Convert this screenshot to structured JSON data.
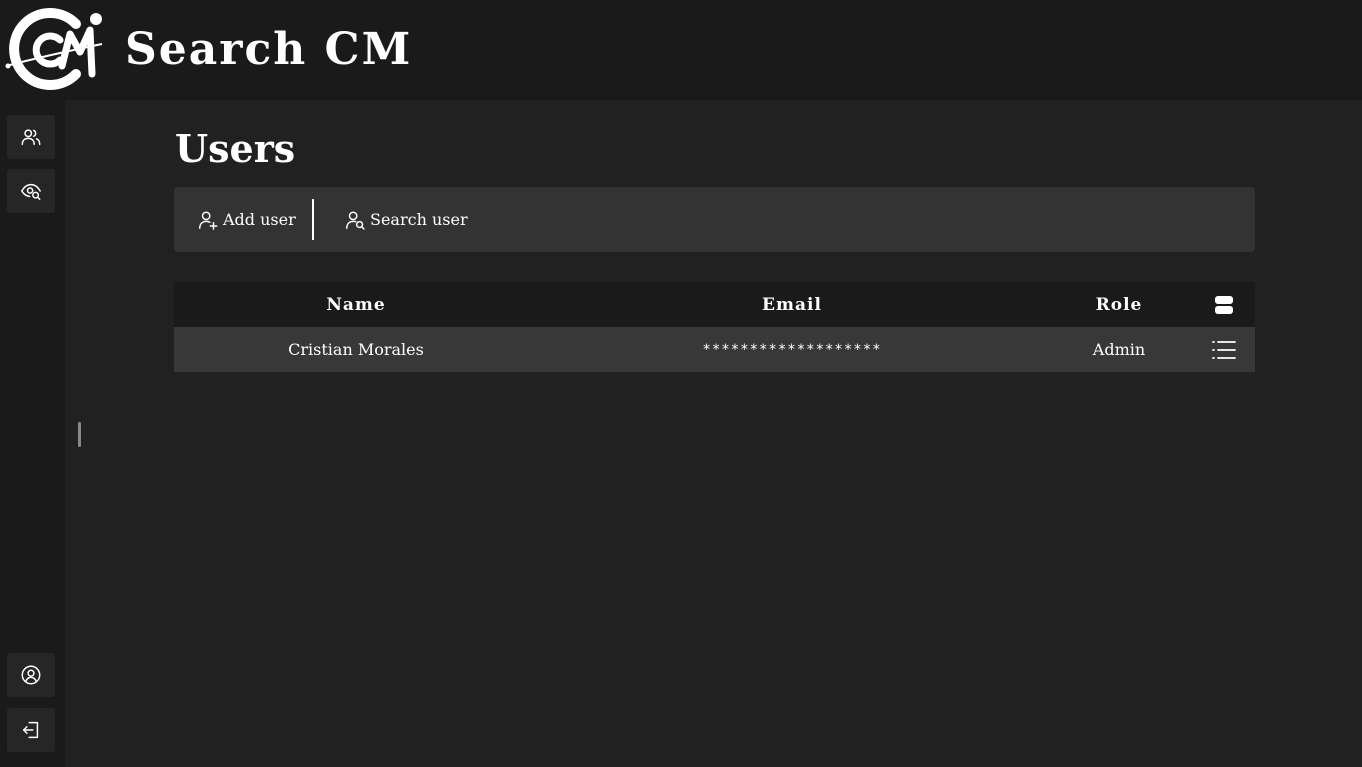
{
  "app": {
    "title": "Search CM",
    "logo_icon": "cm-logo"
  },
  "sidebar": {
    "top_items": [
      {
        "icon": "users-icon",
        "label": "Users"
      },
      {
        "icon": "eye-search-icon",
        "label": "Search"
      }
    ],
    "bottom_items": [
      {
        "icon": "user-circle-icon",
        "label": "Profile"
      },
      {
        "icon": "logout-icon",
        "label": "Logout"
      }
    ]
  },
  "page": {
    "title": "Users"
  },
  "toolbar": {
    "add_label": "Add user",
    "add_icon": "user-plus-icon",
    "search_label": "Search user",
    "search_icon": "user-search-icon"
  },
  "table": {
    "columns": {
      "name": "Name",
      "email": "Email",
      "role": "Role",
      "actions_icon": "server-icon"
    },
    "rows": [
      {
        "name": "Cristian Morales",
        "email": "*******************",
        "role": "Admin",
        "actions_icon": "list-icon"
      }
    ]
  },
  "colors": {
    "background": "#212121",
    "topbar": "#1a1a1a",
    "toolbar": "#333333",
    "row": "#383838",
    "text": "#ffffff"
  }
}
